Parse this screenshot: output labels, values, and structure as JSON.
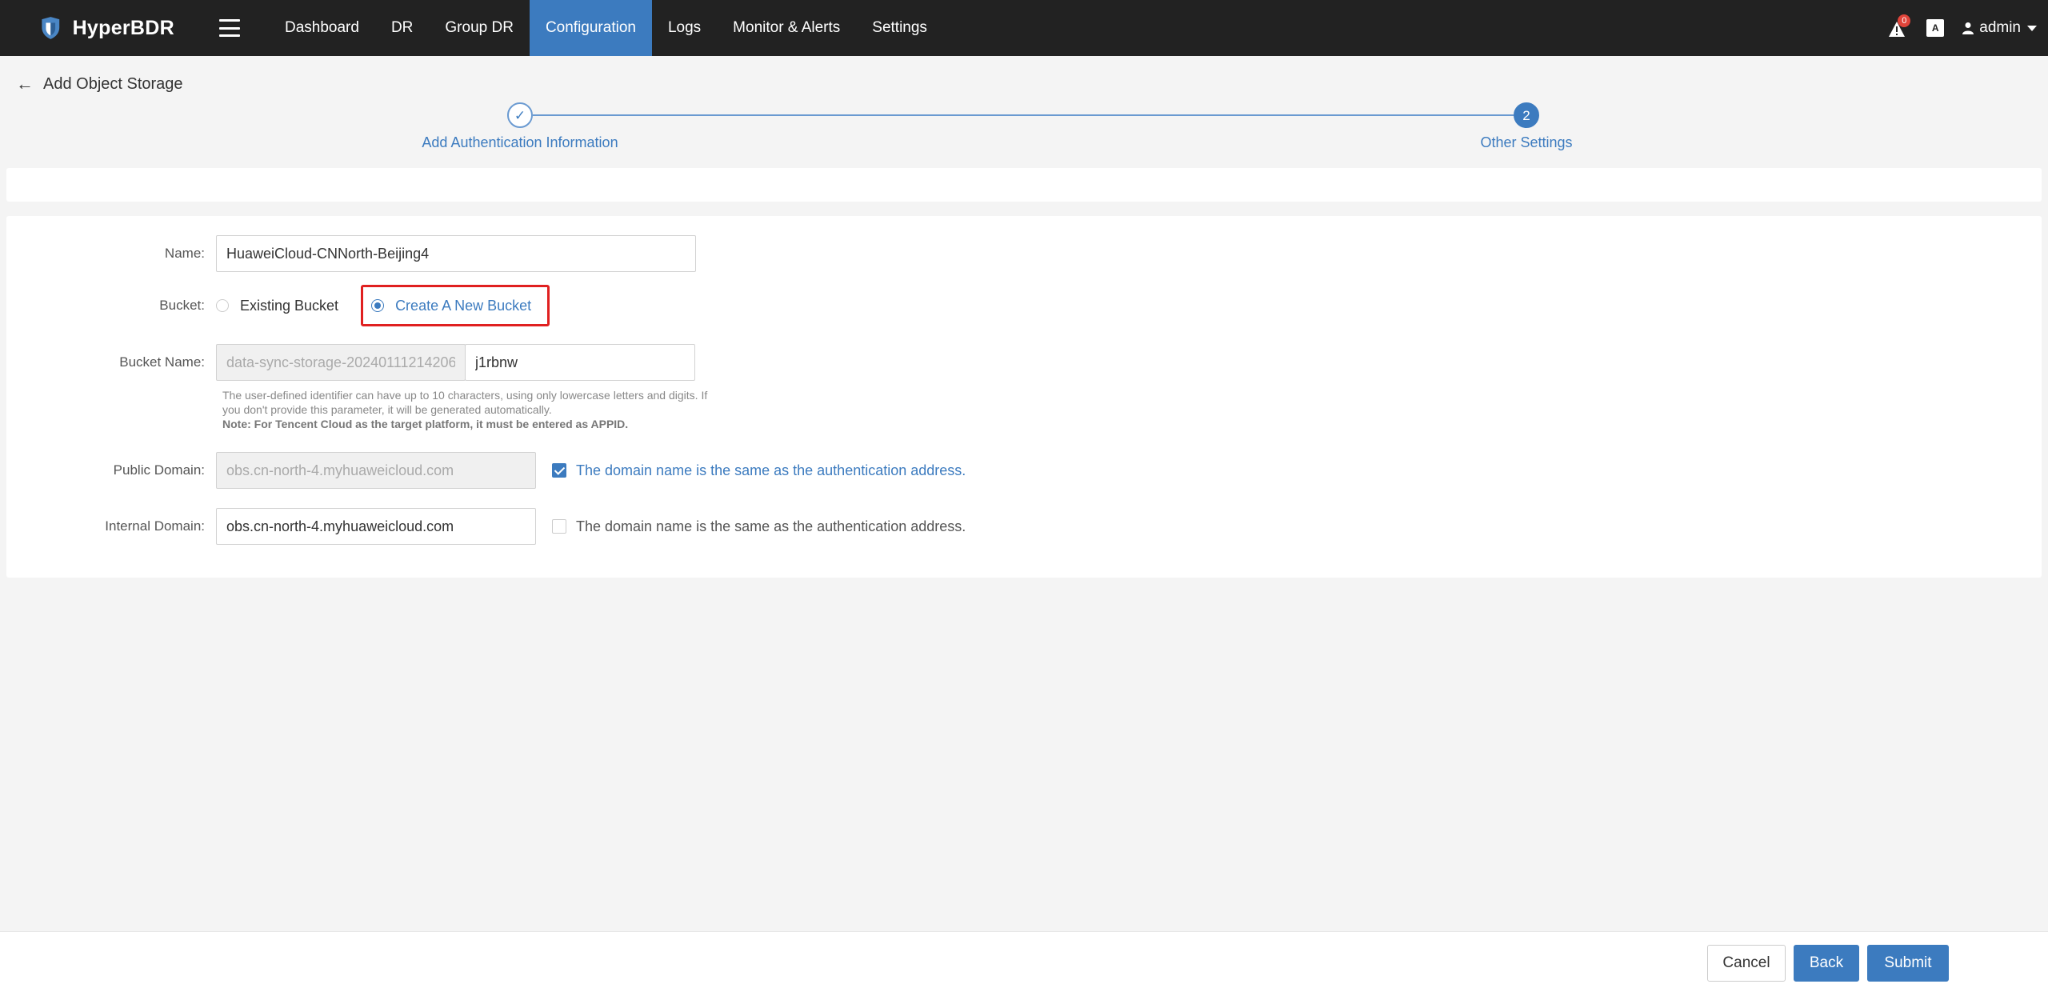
{
  "app": {
    "name": "HyperBDR"
  },
  "nav": {
    "items": [
      "Dashboard",
      "DR",
      "Group DR",
      "Configuration",
      "Logs",
      "Monitor & Alerts",
      "Settings"
    ],
    "active": "Configuration"
  },
  "header": {
    "alert_count": "0",
    "lang_label": "A",
    "user": "admin"
  },
  "page": {
    "title": "Add Object Storage"
  },
  "steps": [
    {
      "label": "Add Authentication Information",
      "marker": "✓"
    },
    {
      "label": "Other Settings",
      "marker": "2"
    }
  ],
  "form": {
    "name": {
      "label": "Name:",
      "value": "HuaweiCloud-CNNorth-Beijing4"
    },
    "bucket": {
      "label": "Bucket:",
      "options": [
        "Existing Bucket",
        "Create A New Bucket"
      ],
      "selected": "Create A New Bucket"
    },
    "bucket_name": {
      "label": "Bucket Name:",
      "prefix": "data-sync-storage-20240111214206-",
      "value": "j1rbnw",
      "help_1": "The user-defined identifier can have up to 10 characters, using only lowercase letters and digits. If you don't provide this parameter, it will be generated automatically.",
      "help_2": "Note: For Tencent Cloud as the target platform, it must be entered as APPID."
    },
    "public_domain": {
      "label": "Public Domain:",
      "value": "obs.cn-north-4.myhuaweicloud.com",
      "same_as_auth": true,
      "checkbox_label": "The domain name is the same as the authentication address."
    },
    "internal_domain": {
      "label": "Internal Domain:",
      "value": "obs.cn-north-4.myhuaweicloud.com",
      "same_as_auth": false,
      "checkbox_label": "The domain name is the same as the authentication address."
    }
  },
  "footer": {
    "cancel": "Cancel",
    "back": "Back",
    "submit": "Submit"
  },
  "colors": {
    "primary": "#3c7bbf",
    "topbar": "#222222",
    "highlight": "#e02020"
  }
}
